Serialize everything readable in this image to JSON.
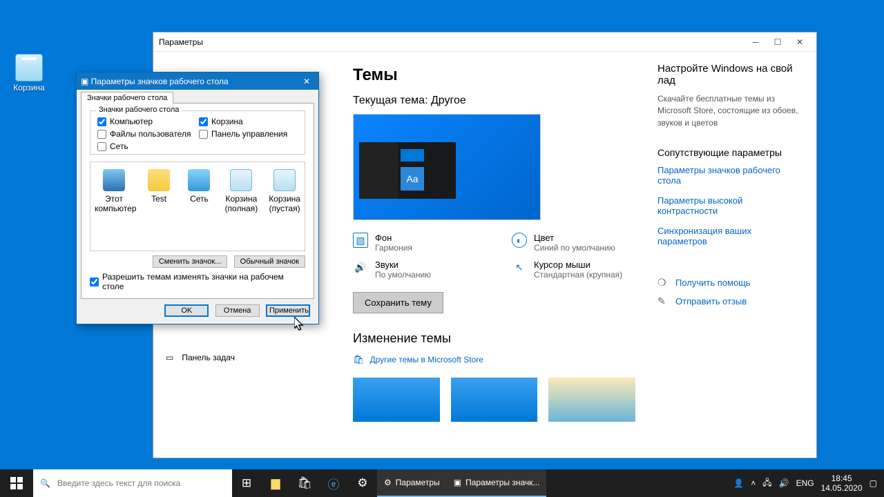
{
  "desktop": {
    "bin_label": "Корзина"
  },
  "settings": {
    "title": "Параметры",
    "page_title": "Темы",
    "current_theme_label": "Текущая тема: Другое",
    "tile_text": "Aa",
    "props": {
      "bg": {
        "title": "Фон",
        "value": "Гармония"
      },
      "color": {
        "title": "Цвет",
        "value": "Синий по умолчанию"
      },
      "sound": {
        "title": "Звуки",
        "value": "По умолчанию"
      },
      "cursor": {
        "title": "Курсор мыши",
        "value": "Стандартная (крупная)"
      }
    },
    "save_btn": "Сохранить тему",
    "change_theme_title": "Изменение темы",
    "store_link": "Другие темы в Microsoft Store",
    "side": {
      "taskbar": "Панель задач"
    }
  },
  "right": {
    "customize_title": "Настройте Windows на свой лад",
    "customize_text": "Скачайте бесплатные темы из Microsoft Store, состоящие из обоев, звуков и цветов",
    "related_title": "Сопутствующие параметры",
    "link1": "Параметры значков рабочего стола",
    "link2": "Параметры высокой контрастности",
    "link3": "Синхронизация ваших параметров",
    "help": "Получить помощь",
    "feedback": "Отправить отзыв"
  },
  "dialog": {
    "title": "Параметры значков рабочего стола",
    "tab": "Значки рабочего стола",
    "group": "Значки рабочего стола",
    "chk_computer": "Компьютер",
    "chk_userfiles": "Файлы пользователя",
    "chk_network": "Сеть",
    "chk_bin": "Корзина",
    "chk_cp": "Панель управления",
    "icons": {
      "pc": "Этот компьютер",
      "user": "Test",
      "net": "Сеть",
      "bin_full": "Корзина (полная)",
      "bin_empty": "Корзина (пустая)"
    },
    "change_icon": "Сменить значок...",
    "default_icon": "Обычный значок",
    "allow_themes": "Разрешить темам изменять значки на рабочем столе",
    "ok": "OK",
    "cancel": "Отмена",
    "apply": "Применить"
  },
  "taskbar": {
    "search_placeholder": "Введите здесь текст для поиска",
    "task1": "Параметры",
    "task2": "Параметры значк...",
    "lang": "ENG",
    "time": "18:45",
    "date": "14.05.2020"
  }
}
